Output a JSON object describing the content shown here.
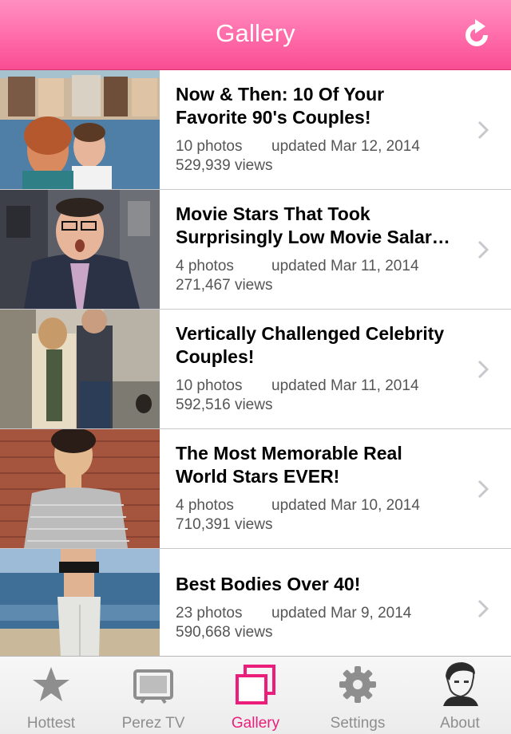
{
  "header": {
    "title": "Gallery"
  },
  "galleries": [
    {
      "title_line1": "Now & Then: 10 Of Your",
      "title_line2": "Favorite 90's Couples!",
      "photos": "10 photos",
      "updated": "updated Mar 12, 2014",
      "views": "529,939 views"
    },
    {
      "title_line1": "Movie Stars That Took",
      "title_line2": "Surprisingly Low Movie Salar…",
      "photos": "4 photos",
      "updated": "updated Mar 11, 2014",
      "views": "271,467 views"
    },
    {
      "title_line1": "Vertically Challenged Celebrity",
      "title_line2": "Couples!",
      "photos": "10 photos",
      "updated": "updated Mar 11, 2014",
      "views": "592,516 views"
    },
    {
      "title_line1": "The Most Memorable Real",
      "title_line2": "World Stars EVER!",
      "photos": "4 photos",
      "updated": "updated Mar 10, 2014",
      "views": "710,391 views"
    },
    {
      "title_line1": "Best Bodies Over 40!",
      "photos": "23 photos",
      "updated": "updated Mar 9, 2014",
      "views": "590,668 views"
    }
  ],
  "tabs": [
    {
      "label": "Hottest",
      "icon": "star-icon"
    },
    {
      "label": "Perez TV",
      "icon": "tv-icon"
    },
    {
      "label": "Gallery",
      "icon": "gallery-icon",
      "active": true
    },
    {
      "label": "Settings",
      "icon": "gear-icon"
    },
    {
      "label": "About",
      "icon": "profile-portrait-icon"
    }
  ],
  "colors": {
    "accent": "#ec1e7c",
    "header_top": "#ff8fc0",
    "header_bottom": "#f84d92",
    "inactive_tab": "#8e8e8e"
  }
}
